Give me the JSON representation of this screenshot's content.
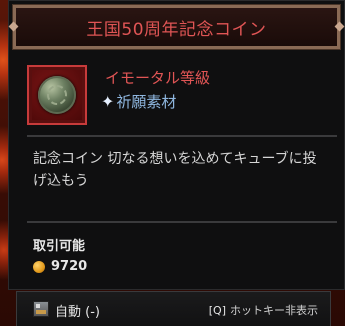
{
  "item": {
    "name": "王国50周年記念コイン",
    "grade": "イモータル等級",
    "category": "祈願素材",
    "description": "記念コイン 切なる想いを込めてキューブに投げ込もう",
    "tradable": "取引可能",
    "price": "9720",
    "icon": "commemorative-coin-icon"
  },
  "footer": {
    "auto_label": "自動 (-)",
    "hotkey_key": "[Q]",
    "hotkey_text": "ホットキー非表示"
  },
  "colors": {
    "title": "#e05555",
    "grade": "#e05555",
    "category": "#8fb7e0",
    "gold": "#e29a1c"
  }
}
